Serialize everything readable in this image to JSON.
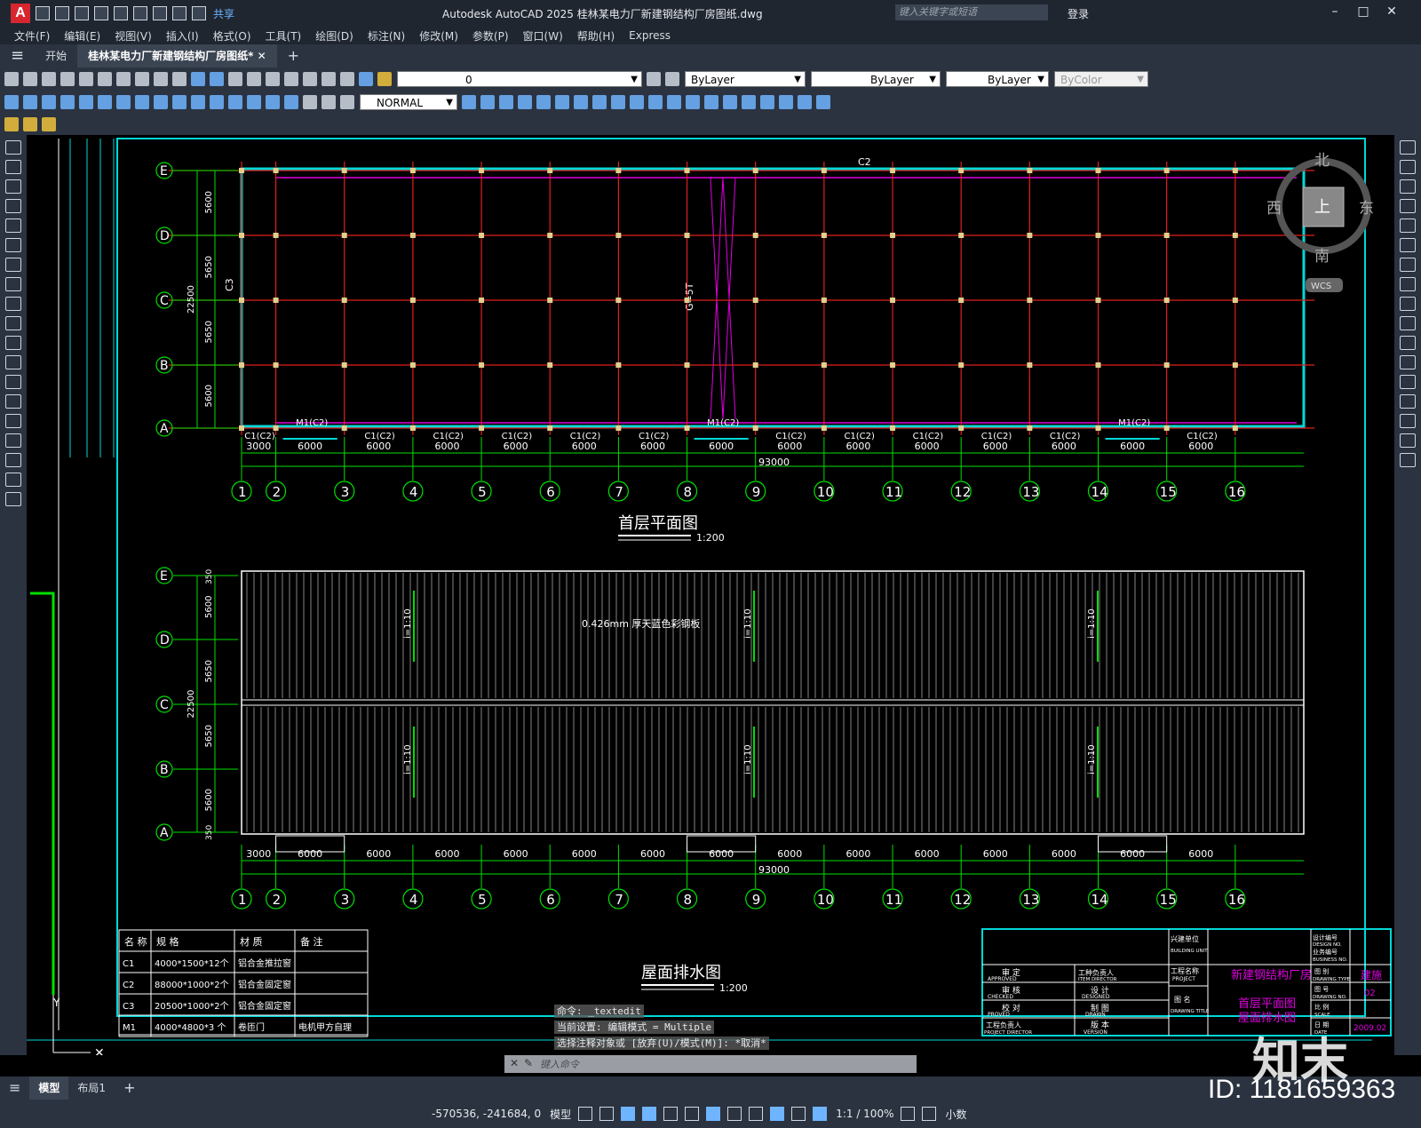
{
  "window": {
    "title": "Autodesk AutoCAD 2025    桂林某电力厂新建钢结构厂房图纸.dwg",
    "share_label": "共享",
    "search_placeholder": "键入关键字或短语",
    "login_label": "登录"
  },
  "menu": [
    "文件(F)",
    "编辑(E)",
    "视图(V)",
    "插入(I)",
    "格式(O)",
    "工具(T)",
    "绘图(D)",
    "标注(N)",
    "修改(M)",
    "参数(P)",
    "窗口(W)",
    "帮助(H)",
    "Express"
  ],
  "tabs": {
    "start": "开始",
    "document": "桂林某电力厂新建钢结构厂房图纸*"
  },
  "properties": {
    "layer_value": "0",
    "color": "ByLayer",
    "linetype": "ByLayer",
    "lineweight": "ByLayer",
    "plotstyle": "ByColor",
    "dimstyle": "NORMAL"
  },
  "viewcube": {
    "north": "北",
    "south": "南",
    "east": "东",
    "west": "西",
    "top": "上",
    "wcs": "WCS"
  },
  "plan": {
    "title": "首层平面图",
    "scale": "1:200",
    "row_labels": [
      "E",
      "D",
      "C",
      "B",
      "A"
    ],
    "row_dims": [
      "5600",
      "5650",
      "5650",
      "5600"
    ],
    "row_total": "22500",
    "col_labels": [
      "1",
      "2",
      "3",
      "4",
      "5",
      "6",
      "7",
      "8",
      "9",
      "10",
      "11",
      "12",
      "13",
      "14",
      "15",
      "16"
    ],
    "col_dims": [
      "3000",
      "6000",
      "6000",
      "6000",
      "6000",
      "6000",
      "6000",
      "6000",
      "6000",
      "6000",
      "6000",
      "6000",
      "6000",
      "6000",
      "6000"
    ],
    "col_total": "93000",
    "window_tags": [
      "C1(C2)",
      "M1(C2)",
      "C1(C2)",
      "C1(C2)",
      "C1(C2)",
      "C1(C2)",
      "C1(C2)",
      "M1(C2)",
      "C1(C2)",
      "C1(C2)",
      "C1(C2)",
      "C1(C2)",
      "C1(C2)",
      "M1(C2)",
      "C1(C2)"
    ],
    "top_tag": "C2",
    "side_tag": "C3",
    "brace_tag": "G=5T"
  },
  "roof": {
    "title": "屋面排水图",
    "scale": "1:200",
    "material_note": "0.426mm 厚天蓝色彩钢板",
    "slope": "i=1:10",
    "edge_dim": "350",
    "row_labels": [
      "E",
      "D",
      "C",
      "B",
      "A"
    ],
    "row_dims": [
      "5600",
      "5650",
      "5650",
      "5600"
    ],
    "row_total": "22500",
    "col_labels": [
      "1",
      "2",
      "3",
      "4",
      "5",
      "6",
      "7",
      "8",
      "9",
      "10",
      "11",
      "12",
      "13",
      "14",
      "15",
      "16"
    ],
    "col_dims": [
      "3000",
      "6000",
      "6000",
      "6000",
      "6000",
      "6000",
      "6000",
      "6000",
      "6000",
      "6000",
      "6000",
      "6000",
      "6000",
      "6000",
      "6000"
    ],
    "col_total": "93000"
  },
  "schedule": {
    "headers": [
      "名 称",
      "规 格",
      "材 质",
      "备 注"
    ],
    "rows": [
      [
        "C1",
        "4000*1500*12个",
        "铝合金推拉窗",
        ""
      ],
      [
        "C2",
        "88000*1000*2个",
        "铝合金固定窗",
        ""
      ],
      [
        "C3",
        "20500*1000*2个",
        "铝合金固定窗",
        ""
      ],
      [
        "M1",
        "4000*4800*3 个",
        "卷匝门",
        "电机甲方自理"
      ]
    ]
  },
  "titleblock": {
    "approved": "审 定",
    "approved_en": "APPROVED",
    "checked": "审 核",
    "checked_en": "CHECKED",
    "proved": "校 对",
    "proved_en": "PROVED",
    "director": "工程负责人",
    "director_en": "PROJECT DIRECTOR",
    "item_director": "工种负责人",
    "item_director_en": "ITEM DIRECTOR",
    "designed": "设 计",
    "designed_en": "DESIGNED",
    "drawn": "制 图",
    "drawn_en": "DRAWN",
    "version": "版 本",
    "version_en": "VERSION",
    "building_unit": "兴建单位",
    "building_unit_en": "BUILDING UNIT",
    "project_label": "工程名称",
    "project_label_en": "PROJECT",
    "drawing_title_label": "图 名",
    "drawing_title_label_en": "DRAWING TITLE",
    "design_no": "设计编号",
    "design_no_en": "DESIGN NO.",
    "business_no": "业务编号",
    "business_no_en": "BUSINESS NO.",
    "drawing_type": "图 别",
    "drawing_type_en": "DRAWING TYPE",
    "drawing_no": "图 号",
    "drawing_no_en": "DRAWING NO.",
    "scale_label": "比 例",
    "scale_label_en": "SCALE",
    "date_label": "日 期",
    "date_label_en": "DATE",
    "project_name": "新建钢结构厂房",
    "drawing_name_1": "首层平面图",
    "drawing_name_2": "屋面排水图",
    "type_value": "建施",
    "number_value": "02",
    "date_value": "2009.02"
  },
  "command": {
    "history": [
      "命令: _textedit",
      "当前设置: 编辑模式 = Multiple",
      "选择注释对象或 [放弃(U)/模式(M)]: *取消*"
    ],
    "placeholder": "键入命令"
  },
  "layouts": [
    "模型",
    "布局1"
  ],
  "status": {
    "coords": "-570536, -241684, 0",
    "model": "模型",
    "scale": "1:1 / 100%",
    "units": "小数"
  },
  "watermark": {
    "id": "ID: 1181659363",
    "logo": "知末"
  },
  "colors": {
    "grid_red": "#e0201a",
    "green": "#00e000",
    "cyan": "#00e0e0",
    "magenta": "#e000e0"
  }
}
